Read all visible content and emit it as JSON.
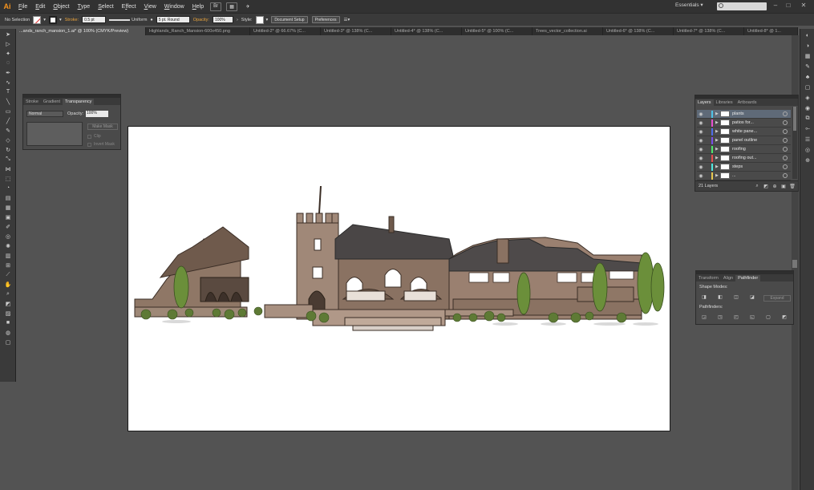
{
  "app": {
    "logo": "Ai"
  },
  "menu": {
    "items": [
      {
        "label": "File",
        "ul": "F",
        "rest": "ile"
      },
      {
        "label": "Edit",
        "ul": "E",
        "rest": "dit"
      },
      {
        "label": "Object",
        "ul": "O",
        "rest": "bject"
      },
      {
        "label": "Type",
        "ul": "T",
        "rest": "ype"
      },
      {
        "label": "Select",
        "ul": "S",
        "rest": "elect"
      },
      {
        "label": "Effect",
        "ul": "C",
        "rest": "ffect",
        "pre": "E"
      },
      {
        "label": "View",
        "ul": "V",
        "rest": "iew"
      },
      {
        "label": "Window",
        "ul": "W",
        "rest": "indow"
      },
      {
        "label": "Help",
        "ul": "H",
        "rest": "elp"
      }
    ],
    "bridge_icon": "Br",
    "workspace": "Essentials ▾"
  },
  "control_bar": {
    "selection": "No Selection",
    "stroke_label": "Stroke:",
    "stroke_weight": "0.5 pt",
    "profile": "Uniform",
    "brush": "5 pt. Round",
    "opacity_label": "Opacity:",
    "opacity_value": "100%",
    "style_label": "Style:",
    "doc_setup": "Document Setup",
    "preferences": "Preferences"
  },
  "tabs": [
    "...ands_ranch_mansion_1.ai* @ 100% (CMYK/Preview)",
    "Highlands_Ranch_Mansion-600x450.png",
    "Untitled-2* @ 66.67% (C...",
    "Untitled-3* @ 138% (C...",
    "Untitled-4* @ 138% (C...",
    "Untitled-5* @ 100% (C...",
    "Trees_vector_collection.ai",
    "Untitled-6* @ 138% (C...",
    "Untitled-7* @ 138% (C...",
    "Untitled-8* @ 1..."
  ],
  "transparency_panel": {
    "tabs": [
      "Stroke",
      "Gradient",
      "Transparency"
    ],
    "blend_mode": "Normal",
    "opacity_label": "Opacity:",
    "opacity_value": "100%",
    "make_mask": "Make Mask",
    "clip": "Clip",
    "invert_mask": "Invert Mask"
  },
  "layers_panel": {
    "tabs": [
      "Layers",
      "Libraries",
      "Artboards"
    ],
    "layers": [
      {
        "name": "plants",
        "color": "#4fc3e8",
        "selected": true
      },
      {
        "name": "patios for...",
        "color": "#e84fd0",
        "selected": false
      },
      {
        "name": "white pane...",
        "color": "#4f6de8",
        "selected": false
      },
      {
        "name": "panel outline",
        "color": "#7a4fe8",
        "selected": false
      },
      {
        "name": "roofing",
        "color": "#4fe86d",
        "selected": false
      },
      {
        "name": "roofing out...",
        "color": "#e84f4f",
        "selected": false
      },
      {
        "name": "steps",
        "color": "#4fe8e0",
        "selected": false
      },
      {
        "name": "...",
        "color": "#e8c84f",
        "selected": false
      }
    ],
    "count": "21 Layers"
  },
  "pathfinder_panel": {
    "tabs": [
      "Transform",
      "Align",
      "Pathfinder"
    ],
    "shape_modes": "Shape Modes:",
    "pathfinders": "Pathfinders:",
    "expand": "Expand"
  },
  "colors": {
    "accent_orange": "#f7941d",
    "stroke_label": "#e8a33d",
    "building": "#8a7262",
    "roof": "#4a4a4a",
    "tree": "#6b8f3a"
  }
}
